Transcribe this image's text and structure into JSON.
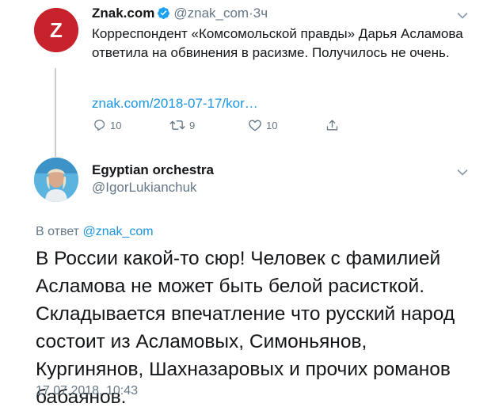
{
  "parent_tweet": {
    "author_name": "Znak.com",
    "handle": "@znak_com",
    "separator": "·",
    "time": "3ч",
    "text": "Корреспондент «Комсомольской правды» Дарья Асламова ответила на обвинения в расизме. Получилось не очень.",
    "link": "znak.com/2018-07-17/kor…",
    "reply_count": "10",
    "retweet_count": "9",
    "like_count": "10",
    "logo_letter": "Z",
    "icons": [
      "reply-icon",
      "retweet-icon",
      "like-icon",
      "share-icon",
      "chevron-down-icon",
      "verified-badge-icon"
    ],
    "logo_color": "#c8222c"
  },
  "reply_tweet": {
    "author_name": "Egyptian orchestra",
    "handle": "@IgorLukianchuk",
    "in_reply_prefix": "В ответ",
    "in_reply_handle": "@znak_com",
    "text": "В России какой-то сюр! Человек с фамилией Асламова не может быть белой расисткой. Складывается впечатление что русский народ состоит из Асламовых, Симоньянов, Кургинянов, Шахназаровых и прочих романов бабаянов.",
    "timestamp": "17.07.2018, 10:43"
  },
  "colors": {
    "link": "#1b95e0",
    "muted": "#657786",
    "text": "#14171a"
  }
}
